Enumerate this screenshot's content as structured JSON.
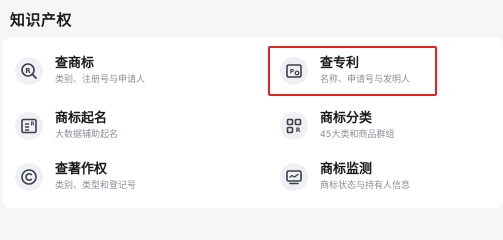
{
  "section": {
    "title": "知识产权"
  },
  "services": [
    {
      "title": "查商标",
      "desc": "类别、注册号与申请人",
      "icon": "trademark-search-icon"
    },
    {
      "title": "查专利",
      "desc": "名称、申请号与发明人",
      "icon": "patent-search-icon"
    },
    {
      "title": "商标起名",
      "desc": "大数据辅助起名",
      "icon": "trademark-naming-icon"
    },
    {
      "title": "商标分类",
      "desc": "45大类和商品群组",
      "icon": "category-grid-icon"
    },
    {
      "title": "查著作权",
      "desc": "类别、类型和登记号",
      "icon": "copyright-icon"
    },
    {
      "title": "商标监测",
      "desc": "商标状态与持有人信息",
      "icon": "monitor-icon"
    }
  ],
  "colors": {
    "highlight": "#e02424",
    "icon_stroke": "#3a3f4a",
    "icon_bg": "#eef0f3"
  }
}
